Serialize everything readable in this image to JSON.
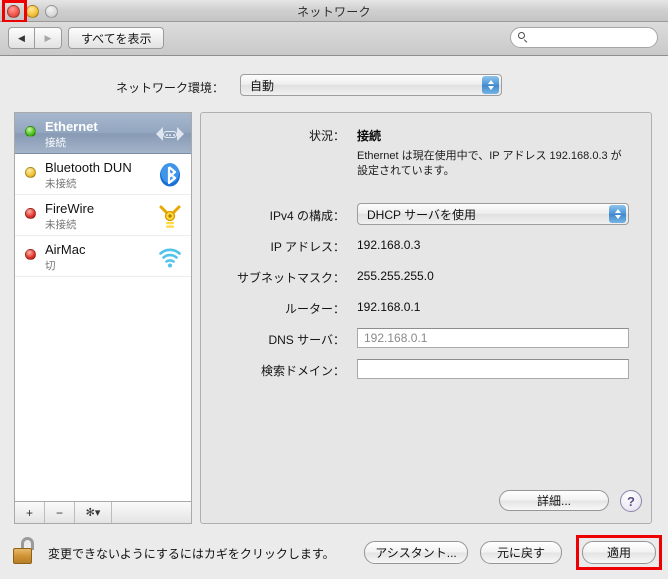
{
  "window": {
    "title": "ネットワーク",
    "traffic_lights": [
      "close-button",
      "minimize-button",
      "zoom-button"
    ]
  },
  "toolbar": {
    "back_label": "◀",
    "forward_label": "▶",
    "show_all_label": "すべてを表示",
    "search": {
      "value": "",
      "placeholder": ""
    }
  },
  "location": {
    "label": "ネットワーク環境：",
    "value": "自動"
  },
  "sidebar": {
    "services": [
      {
        "name": "Ethernet",
        "state": "接続",
        "status_color": "green",
        "icon": "ethernet-icon",
        "selected": true
      },
      {
        "name": "Bluetooth DUN",
        "state": "未接続",
        "status_color": "yellow",
        "icon": "bluetooth-icon",
        "selected": false
      },
      {
        "name": "FireWire",
        "state": "未接続",
        "status_color": "red",
        "icon": "firewire-icon",
        "selected": false
      },
      {
        "name": "AirMac",
        "state": "切",
        "status_color": "red",
        "icon": "airport-wifi-icon",
        "selected": false
      }
    ],
    "footer": {
      "add_label": "+",
      "remove_label": "−",
      "action_label": "✻▾"
    }
  },
  "panel": {
    "status": {
      "label": "状況：",
      "value": "接続",
      "description": "Ethernet は現在使用中で、IP アドレス 192.168.0.3 が設定されています。"
    },
    "fields": [
      {
        "label": "IPv4 の構成：",
        "value": "DHCP サーバを使用"
      },
      {
        "label": "IP アドレス：",
        "value": "192.168.0.3"
      },
      {
        "label": "サブネットマスク：",
        "value": "255.255.255.0"
      },
      {
        "label": "ルーター：",
        "value": "192.168.0.1"
      },
      {
        "label": "DNS サーバ：",
        "value": "192.168.0.1"
      },
      {
        "label": "検索ドメイン：",
        "value": ""
      }
    ],
    "advanced_label": "詳細...",
    "help_label": "?"
  },
  "footer": {
    "lock_text": "変更できないようにするにはカギをクリックします。",
    "assistant_label": "アシスタント...",
    "revert_label": "元に戻す",
    "apply_label": "適用"
  },
  "highlights": {
    "close_button": "#ee0000",
    "apply_button": "#ee0000"
  }
}
